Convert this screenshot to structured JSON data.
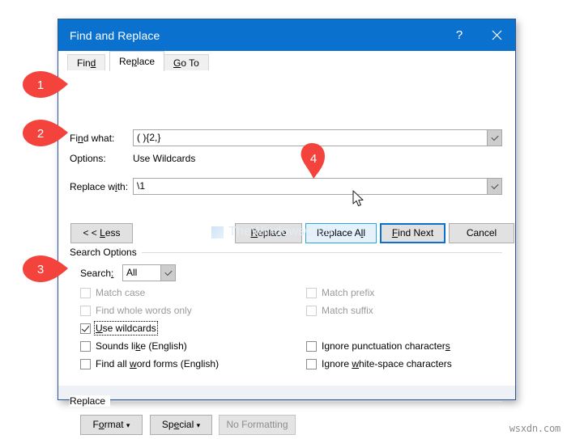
{
  "window": {
    "title": "Find and Replace",
    "help_icon": "question-mark-icon",
    "close_icon": "close-icon"
  },
  "tabs": [
    {
      "id": "find",
      "label": "Find",
      "accel": "d",
      "active": false
    },
    {
      "id": "replace",
      "label": "Replace",
      "accel": "p",
      "active": true
    },
    {
      "id": "goto",
      "label": "Go To",
      "accel": "G",
      "active": false
    }
  ],
  "fields": {
    "find_what": {
      "label": "Find what:",
      "value": "( ){2,}",
      "dropdown_icon": "chevron-down-icon"
    },
    "options": {
      "label": "Options:",
      "value": "Use Wildcards"
    },
    "replace_with": {
      "label": "Replace with:",
      "value": "\\1",
      "dropdown_icon": "chevron-down-icon"
    }
  },
  "buttons": {
    "less": "< < Less",
    "replace": "Replace",
    "replace_all": "Replace All",
    "find_next": "Find Next",
    "cancel": "Cancel"
  },
  "search_options": {
    "group_label": "Search Options",
    "search_label": "Search:",
    "search_value": "All",
    "search_dropdown_icon": "chevron-down-icon",
    "left_checks": [
      {
        "label": "Match case",
        "checked": false,
        "disabled": true,
        "focused": false
      },
      {
        "label": "Find whole words only",
        "checked": false,
        "disabled": true,
        "focused": false
      },
      {
        "label": "Use wildcards",
        "checked": true,
        "disabled": false,
        "focused": true
      },
      {
        "label": "Sounds like (English)",
        "checked": false,
        "disabled": false,
        "focused": false
      },
      {
        "label": "Find all word forms (English)",
        "checked": false,
        "disabled": false,
        "focused": false
      }
    ],
    "right_checks": [
      {
        "label": "Match prefix",
        "checked": false,
        "disabled": true,
        "focused": false
      },
      {
        "label": "Match suffix",
        "checked": false,
        "disabled": true,
        "focused": false
      },
      {
        "label": "Ignore punctuation characters",
        "checked": false,
        "disabled": false,
        "focused": false
      },
      {
        "label": "Ignore white-space characters",
        "checked": false,
        "disabled": false,
        "focused": false
      }
    ]
  },
  "replace_group": {
    "group_label": "Replace",
    "format_button": "Format ▾",
    "special_button": "Special ▾",
    "no_formatting_button": "No Formatting"
  },
  "callouts": [
    {
      "number": "1",
      "target": "find-what-field"
    },
    {
      "number": "2",
      "target": "replace-with-field"
    },
    {
      "number": "3",
      "target": "use-wildcards-checkbox"
    },
    {
      "number": "4",
      "target": "replace-all-button"
    }
  ],
  "watermarks": {
    "center": "TheWindowsClub",
    "corner": "wsxdn.com"
  },
  "colors": {
    "titlebar": "#0b71ce",
    "callout": "#f4433c",
    "default_button_border": "#0b71ce",
    "hover_button_border": "#2ca5e0"
  }
}
